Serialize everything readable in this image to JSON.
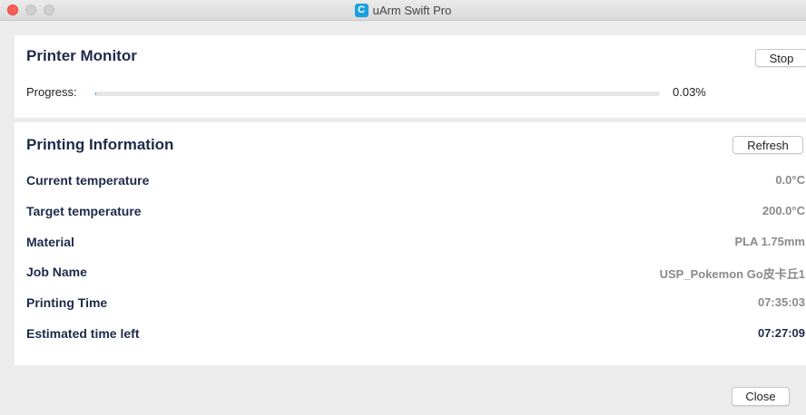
{
  "window": {
    "title": "uArm Swift Pro",
    "app_icon_glyph": "C"
  },
  "monitor": {
    "heading": "Printer Monitor",
    "stop_label": "Stop",
    "progress_label": "Progress:",
    "progress_value": "0.03%",
    "progress_fraction": 0.0003
  },
  "info": {
    "heading": "Printing Information",
    "refresh_label": "Refresh",
    "rows": [
      {
        "label": "Current temperature",
        "value": "0.0°C"
      },
      {
        "label": "Target temperature",
        "value": "200.0°C"
      },
      {
        "label": "Material",
        "value": "PLA 1.75mm"
      },
      {
        "label": "Job Name",
        "value": "USP_Pokemon Go皮卡丘1"
      },
      {
        "label": "Printing Time",
        "value": "07:35:03"
      },
      {
        "label": "Estimated time left",
        "value": "07:27:09"
      }
    ]
  },
  "footer": {
    "close_label": "Close"
  },
  "colors": {
    "heading": "#1e2a4a",
    "value_gray": "#8a8a8a",
    "accent": "#1aa0e0",
    "close_light": "#fc5f57"
  }
}
